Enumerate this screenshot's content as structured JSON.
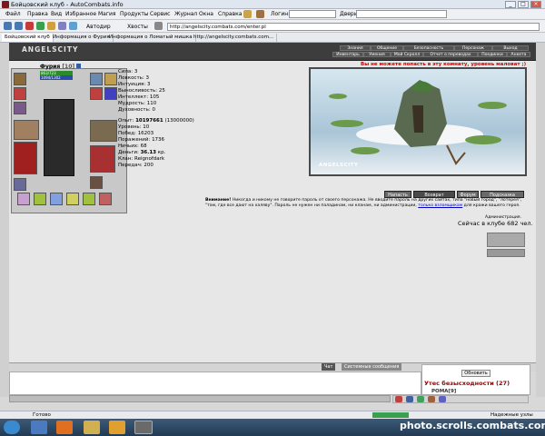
{
  "window": {
    "title": "Бойцовский клуб - AutoCombats.info"
  },
  "menu": [
    "Файл",
    "Правка",
    "Вид",
    "Избранное",
    "Магия",
    "Продукты",
    "Сервис",
    "Журнал",
    "Окна",
    "Справка"
  ],
  "toolbar": {
    "dropdown_1": "Автодир",
    "dropdown_2": "Хвосты",
    "login_label": "Логин:",
    "doors_label": "Двери:",
    "address": "http://angelscity.combats.com/enter.pl"
  },
  "tabs": [
    {
      "label": "Бойцовский клуб"
    },
    {
      "label": "Информация о Фурия"
    },
    {
      "label": "Информация о Ломатый мишка"
    },
    {
      "label": "http://angelscity.combats.com..."
    }
  ],
  "game": {
    "logo": "ANGELSCITY",
    "nav_top": [
      "Знания",
      "Общение",
      "Безопасность",
      "Персонаж",
      "Выход"
    ],
    "nav_bottom": [
      "Инвентарь",
      "Умения",
      "Мой Скролл",
      "Отчет о переводах",
      "Поединки",
      "Анкета"
    ],
    "alert": "Вы не можете попасть в эту комнату, уровень маловат ;)",
    "scene_label": "ANGELSCITY"
  },
  "character": {
    "name": "Фурия",
    "level": "[10]",
    "hp": "863/723",
    "mp": "1094/1302",
    "stats": [
      {
        "label": "Сила:",
        "value": "3"
      },
      {
        "label": "Ловкость:",
        "value": "3"
      },
      {
        "label": "Интуиция:",
        "value": "3"
      },
      {
        "label": "Выносливость:",
        "value": "25"
      },
      {
        "label": "Интеллект:",
        "value": "105"
      },
      {
        "label": "Мудрость:",
        "value": "110"
      },
      {
        "label": "Духовность:",
        "value": "0"
      }
    ],
    "exp_label": "Опыт:",
    "exp_value": "10197661",
    "exp_next": "(13000000)",
    "info": [
      {
        "label": "Уровень:",
        "value": "10"
      },
      {
        "label": "Побед:",
        "value": "16203"
      },
      {
        "label": "Поражений:",
        "value": "1736"
      },
      {
        "label": "Ничьих:",
        "value": "68"
      }
    ],
    "money_label": "Деньги:",
    "money_value": "36.13",
    "money_unit": "кр.",
    "clan_label": "Клан:",
    "clan_value": "Reignofdark",
    "transfers_label": "Передач:",
    "transfers_value": "200"
  },
  "actions": [
    "Напасть",
    "Возврат",
    "Форум",
    "Подсказка"
  ],
  "warning": {
    "bold": "Внимание!",
    "text": "Никогда и никому не говорите пароль от своего персонажа. Не вводите пароль на других сайтах, типа \"новый город\", \"лотерея\", \"там, где все дают на халяву\". Пароль не нужен ни паладинам, ни кланам, ни администрации,",
    "link": "только взломщикам",
    "text2": "для кражи вашего героя.",
    "sign": "Администрация."
  },
  "online_count": "Сейчас в клубе 682 чел.",
  "chat": {
    "tab_chat": "Чат",
    "tab_system": "Системные сообщения",
    "refresh": "Обновить",
    "room": "Утес безысходности (27)",
    "player": "РОМА[9]"
  },
  "status": {
    "ready": "Готово",
    "secure": "Надежные узлы"
  },
  "watermark": "photo.scrolls.combats.com",
  "colors": {
    "alert": "#d00000",
    "link": "#0000c0",
    "room": "#900000"
  }
}
